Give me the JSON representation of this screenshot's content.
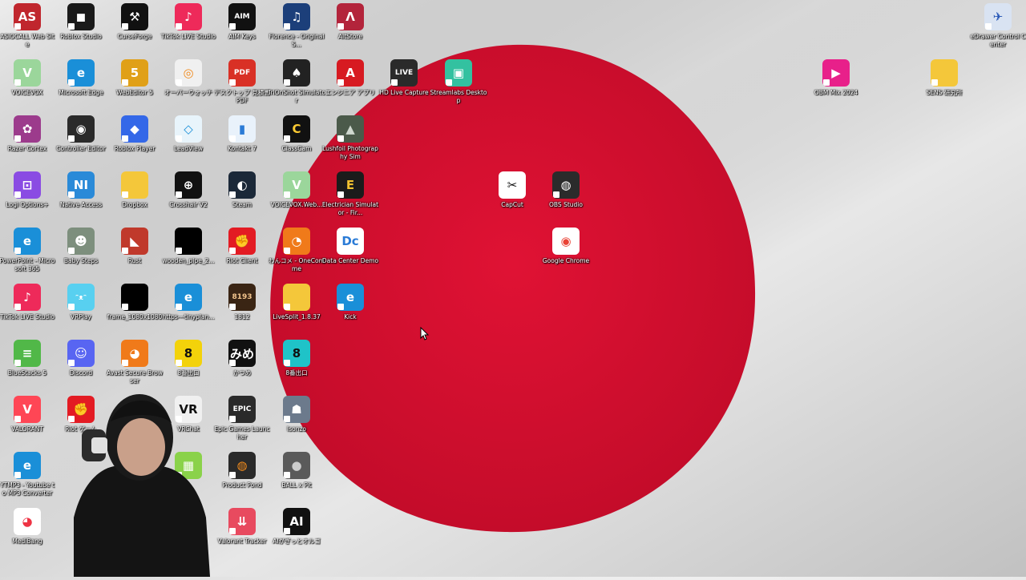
{
  "desktop": {
    "wallpaper": {
      "background": "#e6e6e6",
      "sun_color": "#d50f2e"
    },
    "icons": [
      {
        "label": "ASIOCALL Web Site",
        "glyph": "AS",
        "bg": "#c0262d",
        "fg": "#fff"
      },
      {
        "label": "Roblox Studio",
        "glyph": "◼",
        "bg": "#1a1a1a",
        "fg": "#fff"
      },
      {
        "label": "CurseForge",
        "glyph": "⚒",
        "bg": "#111111",
        "fg": "#fff"
      },
      {
        "label": "TikTok LIVE Studio",
        "glyph": "♪",
        "bg": "#ee2a5a",
        "fg": "#fff"
      },
      {
        "label": "AIM Keys",
        "glyph": "AIM",
        "bg": "#111111",
        "fg": "#fff"
      },
      {
        "label": "Florence - Original S...",
        "glyph": "♫",
        "bg": "#1c3f7a",
        "fg": "#fff"
      },
      {
        "label": "AltStore",
        "glyph": "Λ",
        "bg": "#b3243b",
        "fg": "#fff"
      },
      {
        "label": "VOICEVOX",
        "glyph": "V",
        "bg": "#9bd69b",
        "fg": "#fff"
      },
      {
        "label": "Microsoft Edge",
        "glyph": "e",
        "bg": "#1a8fd8",
        "fg": "#fff"
      },
      {
        "label": "WebEditor 5",
        "glyph": "5",
        "bg": "#e0a018",
        "fg": "#fff"
      },
      {
        "label": "オーバーウォッチ",
        "glyph": "◎",
        "bg": "#f0f0f0",
        "fg": "#f08a1c"
      },
      {
        "label": "デスクトップ 見積書 PDF",
        "glyph": "PDF",
        "bg": "#d93025",
        "fg": "#fff"
      },
      {
        "label": "TriOnShot Simulator",
        "glyph": "♠",
        "bg": "#222222",
        "fg": "#fff"
      },
      {
        "label": "エンジニア アプリ",
        "glyph": "A",
        "bg": "#d71a21",
        "fg": "#fff"
      },
      {
        "label": "HD Live Capture",
        "glyph": "LIVE",
        "bg": "#2a2a2a",
        "fg": "#fff"
      },
      {
        "label": "Streamlabs Desktop",
        "glyph": "▣",
        "bg": "#33c1a0",
        "fg": "#fff"
      },
      {
        "label": "Razer Cortex",
        "glyph": "✿",
        "bg": "#9c3b8c",
        "fg": "#fff"
      },
      {
        "label": "Controller Editor",
        "glyph": "◉",
        "bg": "#2a2a2a",
        "fg": "#fff"
      },
      {
        "label": "Roblox Player",
        "glyph": "◆",
        "bg": "#3468e8",
        "fg": "#fff"
      },
      {
        "label": "LeadView",
        "glyph": "◇",
        "bg": "#e8f4fb",
        "fg": "#1a8fd8"
      },
      {
        "label": "Kontakt 7",
        "glyph": "▮",
        "bg": "#e9f2fb",
        "fg": "#2b7bd6"
      },
      {
        "label": "ClassCam",
        "glyph": "C",
        "bg": "#111111",
        "fg": "#ffcc33"
      },
      {
        "label": "Lushfoil Photography Sim",
        "glyph": "▲",
        "bg": "#4b5a4a",
        "fg": "#cfd8cf"
      },
      {
        "label": "Logi Options+",
        "glyph": "⊡",
        "bg": "#8a4be3",
        "fg": "#fff"
      },
      {
        "label": "Native Access",
        "glyph": "NI",
        "bg": "#2a8ad8",
        "fg": "#fff"
      },
      {
        "label": "Dropbox",
        "glyph": "",
        "bg": "#f4c73a",
        "fg": "#fff"
      },
      {
        "label": "Crosshair V2",
        "glyph": "⊕",
        "bg": "#111111",
        "fg": "#fff"
      },
      {
        "label": "Steam",
        "glyph": "◐",
        "bg": "#1b2838",
        "fg": "#fff"
      },
      {
        "label": "VOICEVOX.Web...",
        "glyph": "V",
        "bg": "#9bd69b",
        "fg": "#fff"
      },
      {
        "label": "Electrician Simulator - Fir...",
        "glyph": "E",
        "bg": "#1b1b1b",
        "fg": "#f2c230"
      },
      {
        "label": "CapCut",
        "glyph": "✂",
        "bg": "#ffffff",
        "fg": "#111"
      },
      {
        "label": "OBS Studio",
        "glyph": "◍",
        "bg": "#2b2b2b",
        "fg": "#fff"
      },
      {
        "label": "PowerPoint - Microsoft 365",
        "glyph": "e",
        "bg": "#1a8fd8",
        "fg": "#fff"
      },
      {
        "label": "Baby Steps",
        "glyph": "☻",
        "bg": "#7d8f7d",
        "fg": "#fff"
      },
      {
        "label": "Rust",
        "glyph": "◣",
        "bg": "#c0392b",
        "fg": "#fff"
      },
      {
        "label": "wooden_pipe_2...",
        "glyph": "",
        "bg": "#000000",
        "fg": "#fff"
      },
      {
        "label": "Riot Client",
        "glyph": "✊",
        "bg": "#e31b23",
        "fg": "#fff"
      },
      {
        "label": "わんコメ - OneComme",
        "glyph": "◔",
        "bg": "#f07a1a",
        "fg": "#fff"
      },
      {
        "label": "Data Center Demo",
        "glyph": "Dc",
        "bg": "#ffffff",
        "fg": "#2a7bd6"
      },
      {
        "label": "Google Chrome",
        "glyph": "◉",
        "bg": "#ffffff",
        "fg": "#ea4335"
      },
      {
        "label": "TikTok LIVE Studio",
        "glyph": "♪",
        "bg": "#ee2a5a",
        "fg": "#fff"
      },
      {
        "label": "VRPlay",
        "glyph": "ᵔᴥᵔ",
        "bg": "#58d0f0",
        "fg": "#fff"
      },
      {
        "label": "frame_1080x1080",
        "glyph": "",
        "bg": "#000000",
        "fg": "#fff"
      },
      {
        "label": "https---tinyplan...",
        "glyph": "e",
        "bg": "#1a8fd8",
        "fg": "#fff"
      },
      {
        "label": "1812",
        "glyph": "8193",
        "bg": "#3a2514",
        "fg": "#f2c48d"
      },
      {
        "label": "LiveSplit_1.8.37",
        "glyph": "",
        "bg": "#f4c73a",
        "fg": "#fff"
      },
      {
        "label": "Kick",
        "glyph": "e",
        "bg": "#1a8fd8",
        "fg": "#fff"
      },
      {
        "label": "BlueStacks 5",
        "glyph": "≡",
        "bg": "#51b848",
        "fg": "#fff"
      },
      {
        "label": "Discord",
        "glyph": "☺",
        "bg": "#5865f2",
        "fg": "#fff"
      },
      {
        "label": "Avast Secure Browser",
        "glyph": "◕",
        "bg": "#f07a1a",
        "fg": "#fff"
      },
      {
        "label": "8番出口",
        "glyph": "8",
        "bg": "#f3d20a",
        "fg": "#111"
      },
      {
        "label": "かつめ",
        "glyph": "みめ",
        "bg": "#111111",
        "fg": "#fff"
      },
      {
        "label": "8番出口",
        "glyph": "8",
        "bg": "#1fc3c8",
        "fg": "#111"
      },
      {
        "label": "VALORANT",
        "glyph": "V",
        "bg": "#ff4655",
        "fg": "#fff"
      },
      {
        "label": "Riot ゲーム",
        "glyph": "✊",
        "bg": "#e31b23",
        "fg": "#fff"
      },
      {
        "label": "VRChat",
        "glyph": "VR",
        "bg": "#f0f0f0",
        "fg": "#111"
      },
      {
        "label": "Epic Games Launcher",
        "glyph": "EPIC",
        "bg": "#2a2a2a",
        "fg": "#fff"
      },
      {
        "label": "Isonzo",
        "glyph": "☗",
        "bg": "#6c7a8c",
        "fg": "#fff"
      },
      {
        "label": "YTMP3 - Youtube to MP3 Converter",
        "glyph": "e",
        "bg": "#1a8fd8",
        "fg": "#fff"
      },
      {
        "label": "",
        "glyph": "▦",
        "bg": "#8ad24a",
        "fg": "#fff"
      },
      {
        "label": "Product Pond",
        "glyph": "◍",
        "bg": "#2a2a2a",
        "fg": "#f08a1c"
      },
      {
        "label": "BALL x Pit",
        "glyph": "●",
        "bg": "#5a5a5a",
        "fg": "#ccc"
      },
      {
        "label": "MediBang",
        "glyph": "◕",
        "bg": "#ffffff",
        "fg": "#e34"
      },
      {
        "label": "Valorant Tracker",
        "glyph": "⇊",
        "bg": "#e84a5f",
        "fg": "#fff"
      },
      {
        "label": "AIがぎっとオルゴ",
        "glyph": "AI",
        "bg": "#111111",
        "fg": "#fff"
      },
      {
        "label": "OBM Mix 2024",
        "glyph": "▶",
        "bg": "#e8208a",
        "fg": "#fff"
      },
      {
        "label": "SENS 研究所",
        "glyph": "",
        "bg": "#f4c73a",
        "fg": "#fff"
      },
      {
        "label": "eDrawer Control Center",
        "glyph": "✈",
        "bg": "#d9e3f2",
        "fg": "#2a5ab8"
      }
    ]
  }
}
